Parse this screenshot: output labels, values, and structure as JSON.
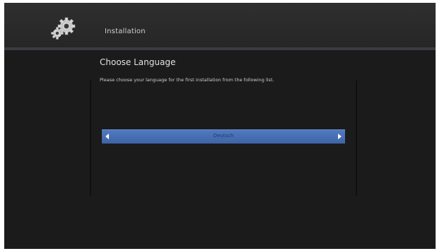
{
  "header": {
    "title": "Installation",
    "icon": "gear-icon"
  },
  "main": {
    "title": "Choose Language",
    "description": "Please choose your language for the first installation from the following list.",
    "language_selector": {
      "value": "Deutsch",
      "left_icon": "arrow-left-icon",
      "right_icon": "arrow-right-icon"
    }
  },
  "colors": {
    "background": "#1b1b1b",
    "header": "#2c2c2c",
    "selector": "#4a70b5"
  }
}
